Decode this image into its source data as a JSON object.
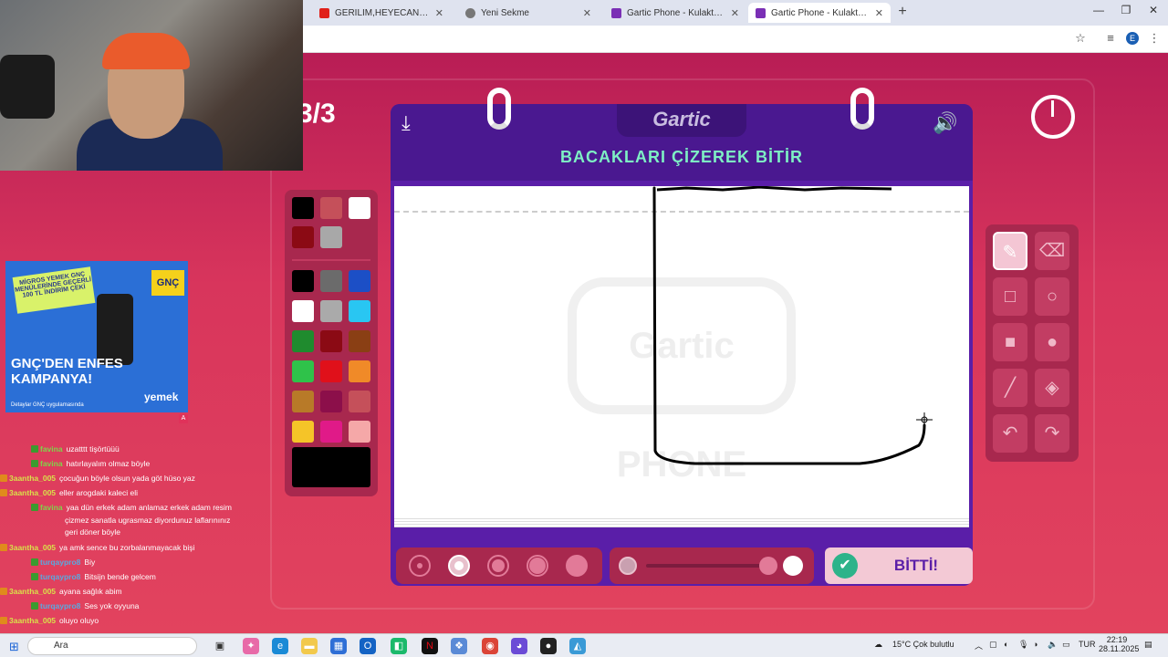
{
  "browser": {
    "tabs": [
      {
        "label": "GERİLİM,HEYECAN VE GİZEM",
        "favicon_color": "#e0201a",
        "active": false
      },
      {
        "label": "Yeni Sekme",
        "favicon_color": "#555555",
        "active": false
      },
      {
        "label": "Gartic Phone - Kulaktan Kulağa",
        "favicon_color": "#7a2fb5",
        "active": false
      },
      {
        "label": "Gartic Phone - Kulaktan Kulağa",
        "favicon_color": "#7a2fb5",
        "active": true
      }
    ],
    "profile_initial": "E"
  },
  "game": {
    "round": "3/3",
    "logo": "Gartic",
    "prompt": "BACAKLARI ÇİZEREK BİTİR",
    "watermark": "Gartic PHONE",
    "done_label": "BİTTİ!",
    "colors": {
      "accent_green": "#7ef0c4",
      "board_purple": "#5a1ea8",
      "panel": "#a8284e"
    },
    "palette_top": [
      "#000000",
      "#c5505a",
      "#ffffff",
      "#8b0a14",
      "#a8a8a8"
    ],
    "palette_main": [
      "#000000",
      "#6b6b6b",
      "#1c4fc6",
      "#ffffff",
      "#aaaaaa",
      "#29c6f2",
      "#1f8b2e",
      "#8b0a14",
      "#8a3f14",
      "#2fc24a",
      "#e0101a",
      "#f08a28",
      "#b87a28",
      "#8c0f4a",
      "#c5505a",
      "#f5c428",
      "#e01a88",
      "#f5a8a8"
    ],
    "selected_color": "#000000",
    "tools": [
      {
        "name": "pen-tool",
        "glyph": "✎",
        "active": true
      },
      {
        "name": "eraser-tool",
        "glyph": "⌫",
        "active": false
      },
      {
        "name": "rectangle-outline-tool",
        "glyph": "□",
        "active": false
      },
      {
        "name": "ellipse-outline-tool",
        "glyph": "○",
        "active": false
      },
      {
        "name": "rectangle-filled-tool",
        "glyph": "■",
        "active": false
      },
      {
        "name": "ellipse-filled-tool",
        "glyph": "●",
        "active": false
      },
      {
        "name": "line-tool",
        "glyph": "╱",
        "active": false
      },
      {
        "name": "fill-bucket-tool",
        "glyph": "◈",
        "active": false
      },
      {
        "name": "undo-tool",
        "glyph": "↶",
        "active": false
      },
      {
        "name": "redo-tool",
        "glyph": "↷",
        "active": false
      }
    ],
    "brush_sizes": [
      1,
      2,
      3,
      4,
      5
    ],
    "selected_brush": 2,
    "opacity_level": 1.0
  },
  "ad": {
    "banner": "MİGROS YEMEK GNÇ MENÜLERİNDE GEÇERLİ 100 TL İNDİRİM ÇEKİ",
    "brand_badge": "GNÇ",
    "headline": "GNÇ'DEN ENFES KAMPANYA!",
    "footer": "Detaylar GNÇ uygulamasında",
    "brand": "yemek",
    "marker": "A"
  },
  "chat": [
    {
      "user": "favina",
      "text": "uzatttt tişörtüüü",
      "badge": "sub",
      "color": "#7fd44a"
    },
    {
      "user": "favina",
      "text": "hatırlayalım olmaz böyle",
      "badge": "sub",
      "color": "#7fd44a"
    },
    {
      "user": "3aantha_005",
      "text": "çocuğun böyle olsun yada göt hüso yaz",
      "badge": "mod",
      "color": "#d9e04a"
    },
    {
      "user": "3aantha_005",
      "text": "eller arogdaki kaleci eli",
      "badge": "mod",
      "color": "#d9e04a"
    },
    {
      "user": "favina",
      "text": "yaa dün erkek adam anlamaz erkek adam resim",
      "badge": "sub",
      "color": "#7fd44a"
    },
    {
      "user": "",
      "text": "çizmez sanatla ugrasmaz diyordunuz laflarınınız",
      "badge": "",
      "color": "#ffffff"
    },
    {
      "user": "",
      "text": "geri döner böyle",
      "badge": "",
      "color": "#ffffff"
    },
    {
      "user": "3aantha_005",
      "text": "ya amk sence bu zorbalanmayacak bişi",
      "badge": "mod",
      "color": "#d9e04a"
    },
    {
      "user": "turqaypro8",
      "text": "Biy",
      "badge": "sub",
      "color": "#5aa9e0"
    },
    {
      "user": "turqaypro8",
      "text": "Bitsijn bende gelcem",
      "badge": "sub",
      "color": "#5aa9e0"
    },
    {
      "user": "3aantha_005",
      "text": "ayana sağlık abim",
      "badge": "mod",
      "color": "#d9e04a"
    },
    {
      "user": "turqaypro8",
      "text": "Ses yok oyyuna",
      "badge": "sub",
      "color": "#5aa9e0"
    },
    {
      "user": "3aantha_005",
      "text": "oluyo oluyo",
      "badge": "mod",
      "color": "#d9e04a"
    }
  ],
  "taskbar": {
    "search_label": "Ara",
    "weather": "15°C  Çok bulutlu",
    "language": "TUR",
    "time": "22:19",
    "date": "28.11.2025"
  }
}
